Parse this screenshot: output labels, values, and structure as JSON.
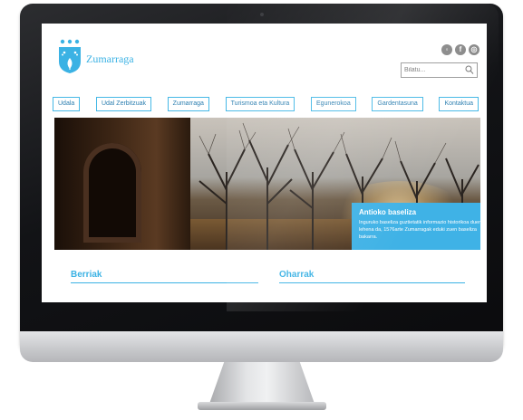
{
  "site": {
    "name": "Zumarraga",
    "logo_icon": "coat-of-arms-icon",
    "social_icons": [
      "share-icon",
      "facebook-icon",
      "globe-icon"
    ]
  },
  "search": {
    "placeholder": "Bilatu...",
    "value": "",
    "icon": "search-icon"
  },
  "nav": {
    "items": [
      {
        "label": "Udala"
      },
      {
        "label": "Udal Zerbitzuak"
      },
      {
        "label": "Zumarraga"
      },
      {
        "label": "Turismoa eta Kultura"
      },
      {
        "label": "Egunerokoa"
      },
      {
        "label": "Gardentasuna"
      },
      {
        "label": "Kontaktua"
      }
    ]
  },
  "hero": {
    "caption_title": "Antioko baseliza",
    "caption_text": "Inguruko baseliza guztietatik informazio historikoa duen lehena da, 1576arte Zumarragak eduki zuen baseliza bakarra."
  },
  "sections": {
    "news": "Berriak",
    "notices": "Oharrak"
  },
  "colors": {
    "accent": "#3bb2e4",
    "caption_bg": "#3fb2e6"
  }
}
